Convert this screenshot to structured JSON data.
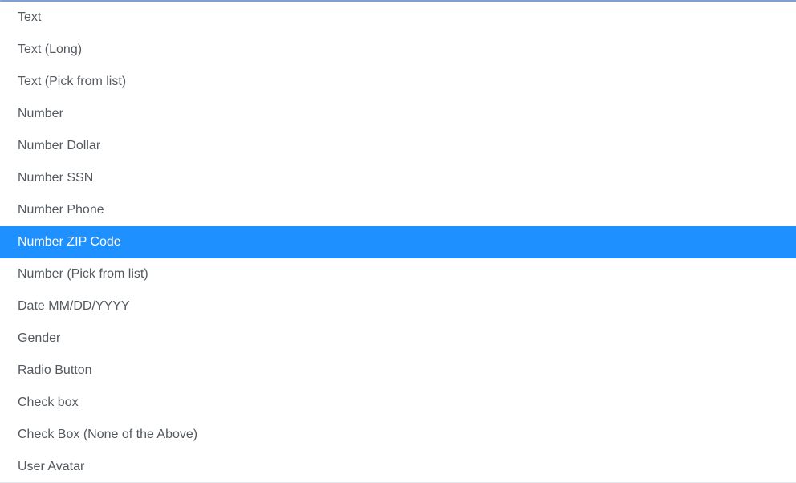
{
  "panel": {
    "kind": "dropdown-option-list",
    "selected_index": 8,
    "colors": {
      "background": "#ffffff",
      "text": "#54595f",
      "selected_background": "#1e90ff",
      "selected_text": "#ffffff",
      "top_border": "#7f9fd1",
      "left_border": "#8aa5d3",
      "bottom_border": "#e3e8f0"
    }
  },
  "options": [
    {
      "label": "Text",
      "selected": false
    },
    {
      "label": "Text (Long)",
      "selected": false
    },
    {
      "label": "Text (Pick from list)",
      "selected": false
    },
    {
      "label": "Number",
      "selected": false
    },
    {
      "label": "Number Dollar",
      "selected": false
    },
    {
      "label": "Number SSN",
      "selected": false
    },
    {
      "label": "Number Phone",
      "selected": false
    },
    {
      "label": "Number ZIP Code",
      "selected": true
    },
    {
      "label": "Number (Pick from list)",
      "selected": false
    },
    {
      "label": "Date MM/DD/YYYY",
      "selected": false
    },
    {
      "label": "Gender",
      "selected": false
    },
    {
      "label": "Radio Button",
      "selected": false
    },
    {
      "label": "Check box",
      "selected": false
    },
    {
      "label": "Check Box (None of the Above)",
      "selected": false
    },
    {
      "label": "User Avatar",
      "selected": false
    }
  ]
}
